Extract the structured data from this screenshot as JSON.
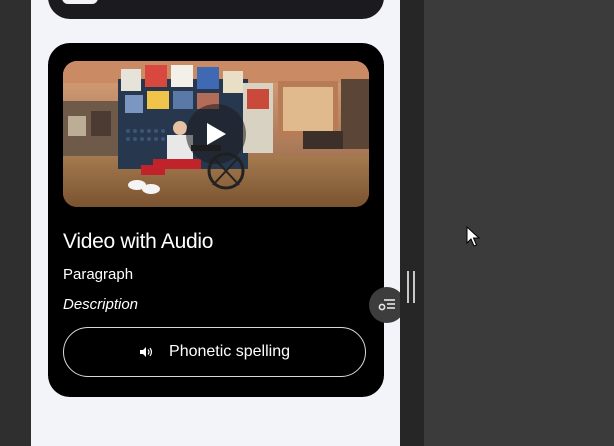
{
  "media_card": {
    "title": "Video with Audio",
    "paragraph": "Paragraph",
    "description": "Description",
    "phonetic_button_label": "Phonetic spelling"
  },
  "icons": {
    "play": "play-icon",
    "speaker": "speaker-icon",
    "menu": "filter-menu-icon",
    "cursor": "mouse-pointer-icon"
  },
  "colors": {
    "card_background": "#000000",
    "preview_background": "#f3f4f9",
    "editor_background": "#3b3b3b"
  }
}
